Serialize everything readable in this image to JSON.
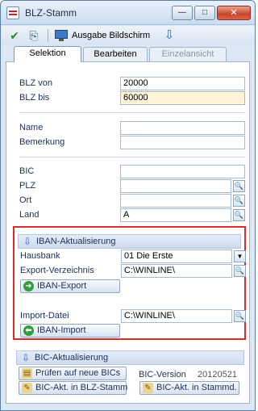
{
  "window": {
    "title": "BLZ-Stamm",
    "min_glyph": "—",
    "max_glyph": "□",
    "close_glyph": "✕"
  },
  "toolbar": {
    "output_label": "Ausgabe Bildschirm",
    "icons": [
      "checkmark-icon",
      "exit-icon",
      "monitor-icon",
      "arrow-down-icon"
    ]
  },
  "tabs": [
    {
      "label": "Selektion",
      "active": true
    },
    {
      "label": "Bearbeiten",
      "active": false
    },
    {
      "label": "Einzelansicht",
      "active": false,
      "disabled": true
    }
  ],
  "form": {
    "blz_von": {
      "label": "BLZ von",
      "value": "20000"
    },
    "blz_bis": {
      "label": "BLZ bis",
      "value": "60000"
    },
    "name": {
      "label": "Name",
      "value": ""
    },
    "bemerkung": {
      "label": "Bemerkung",
      "value": ""
    },
    "bic": {
      "label": "BIC",
      "value": ""
    },
    "plz": {
      "label": "PLZ",
      "value": ""
    },
    "ort": {
      "label": "Ort",
      "value": ""
    },
    "land": {
      "label": "Land",
      "value": "A"
    }
  },
  "iban": {
    "header": "IBAN-Aktualisierung",
    "hausbank": {
      "label": "Hausbank",
      "value": "01  Die Erste"
    },
    "export_dir": {
      "label": "Export-Verzeichnis",
      "value": "C:\\WINLINE\\"
    },
    "export_button": "IBAN-Export",
    "import_file": {
      "label": "Import-Datei",
      "value": "C:\\WINLINE\\"
    },
    "import_button": "IBAN-Import"
  },
  "bic_section": {
    "header": "BIC-Aktualisierung",
    "check_button": "Prüfen auf neue BICs",
    "version_label": "BIC-Version",
    "version_value": "20120521",
    "update_blz_button": "BIC-Akt. in BLZ-Stamm",
    "update_master_button": "BIC-Akt. in Stammd."
  },
  "colors": {
    "accent_blue": "#2c69c8",
    "highlight_red": "#d92b2b",
    "field_yellow": "#fff5d6",
    "label_text": "#1c2f5a"
  }
}
